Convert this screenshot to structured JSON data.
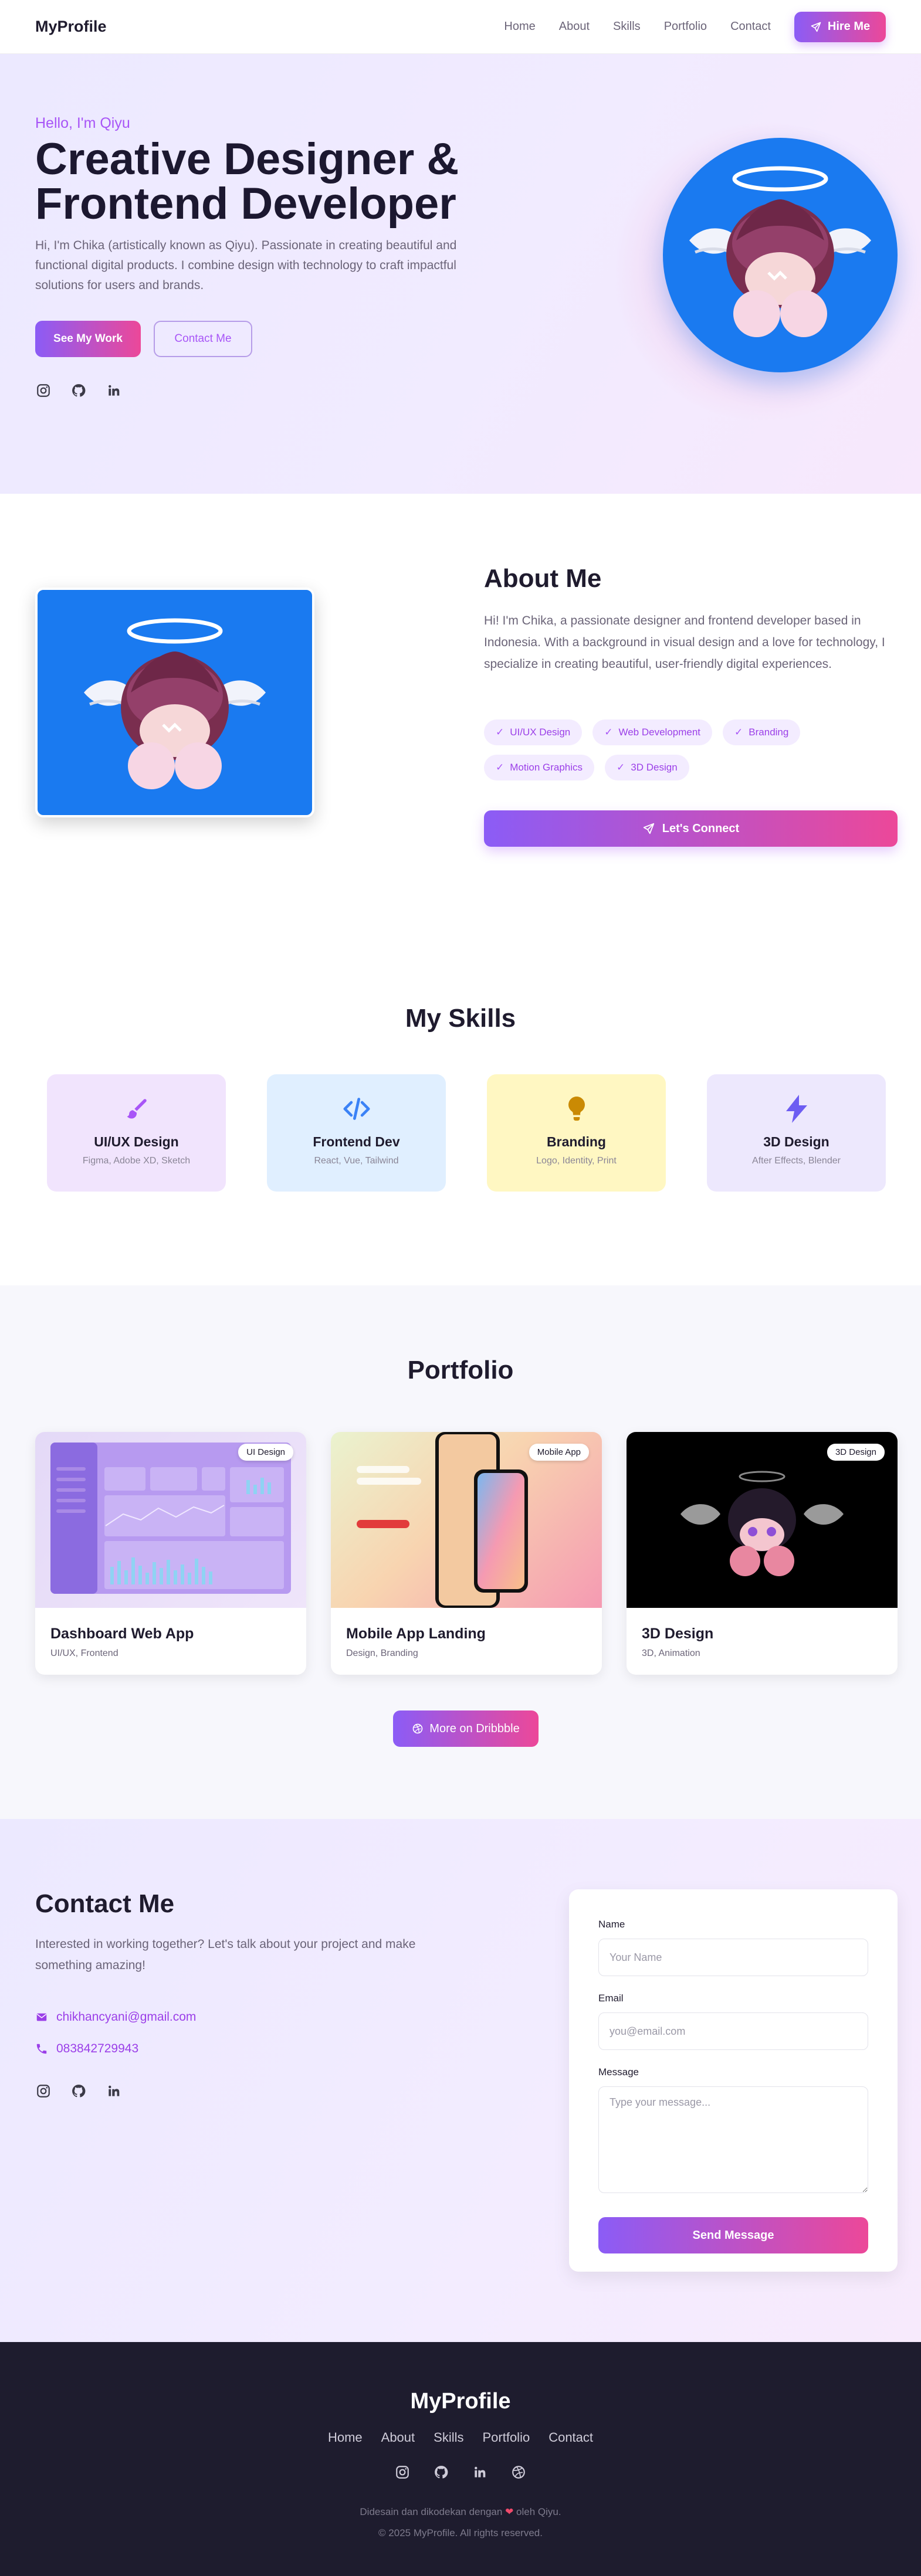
{
  "nav": {
    "brand": "MyProfile",
    "links": [
      "Home",
      "About",
      "Skills",
      "Portfolio",
      "Contact"
    ],
    "hire_label": "Hire Me"
  },
  "hero": {
    "hello": "Hello, I'm Qiyu",
    "title_line1": "Creative Designer &",
    "title_line2": "Frontend Developer",
    "description": "Hi, I'm Chika (artistically known as Qiyu). Passionate in creating beautiful and functional digital products. I combine design with technology to craft impactful solutions for users and brands.",
    "primary_btn": "See My Work",
    "secondary_btn": "Contact Me",
    "social_icons": [
      "instagram-icon",
      "github-icon",
      "linkedin-icon"
    ]
  },
  "about": {
    "title": "About Me",
    "description": "Hi! I'm Chika, a passionate designer and frontend developer based in Indonesia. With a background in visual design and a love for technology, I specialize in creating beautiful, user-friendly digital experiences.",
    "tags": [
      "UI/UX Design",
      "Web Development",
      "Branding",
      "Motion Graphics",
      "3D Design"
    ],
    "connect_label": "Let's Connect"
  },
  "skills": {
    "title": "My Skills",
    "items": [
      {
        "name": "UI/UX Design",
        "tools": "Figma, Adobe XD, Sketch",
        "icon": "brush-icon",
        "bg": "#f1e4fd",
        "color": "#a855f7"
      },
      {
        "name": "Frontend Dev",
        "tools": "React, Vue, Tailwind",
        "icon": "code-icon",
        "bg": "#e0efff",
        "color": "#3b82f6"
      },
      {
        "name": "Branding",
        "tools": "Logo, Identity, Print",
        "icon": "lightbulb-icon",
        "bg": "#fff7c2",
        "color": "#ca8a04"
      },
      {
        "name": "3D Design",
        "tools": "After Effects, Blender",
        "icon": "bolt-icon",
        "bg": "#ede8fd",
        "color": "#6d5df2"
      }
    ]
  },
  "portfolio": {
    "title": "Portfolio",
    "items": [
      {
        "title": "Dashboard Web App",
        "sub": "UI/UX, Frontend",
        "badge": "UI Design"
      },
      {
        "title": "Mobile App Landing",
        "sub": "Design, Branding",
        "badge": "Mobile App"
      },
      {
        "title": "3D Design",
        "sub": "3D, Animation",
        "badge": "3D Design"
      }
    ],
    "more_label": "More on Dribbble"
  },
  "contact": {
    "title": "Contact Me",
    "description": "Interested in working together? Let's talk about your project and make something amazing!",
    "email": "chikhancyani@gmail.com",
    "phone": "083842729943",
    "form": {
      "name_label": "Name",
      "name_placeholder": "Your Name",
      "email_label": "Email",
      "email_placeholder": "you@email.com",
      "message_label": "Message",
      "message_placeholder": "Type your message...",
      "send_label": "Send Message"
    }
  },
  "footer": {
    "brand": "MyProfile",
    "links": [
      "Home",
      "About",
      "Skills",
      "Portfolio",
      "Contact"
    ],
    "made_prefix": "Didesain dan dikodekan dengan",
    "made_suffix": "oleh Qiyu.",
    "copyright": "© 2025 MyProfile. All rights reserved."
  },
  "colors": {
    "accent_start": "#8b5cf6",
    "accent_end": "#ec4899",
    "avatar_bg": "#1a7af0",
    "footer_bg": "#1e1c2e"
  }
}
